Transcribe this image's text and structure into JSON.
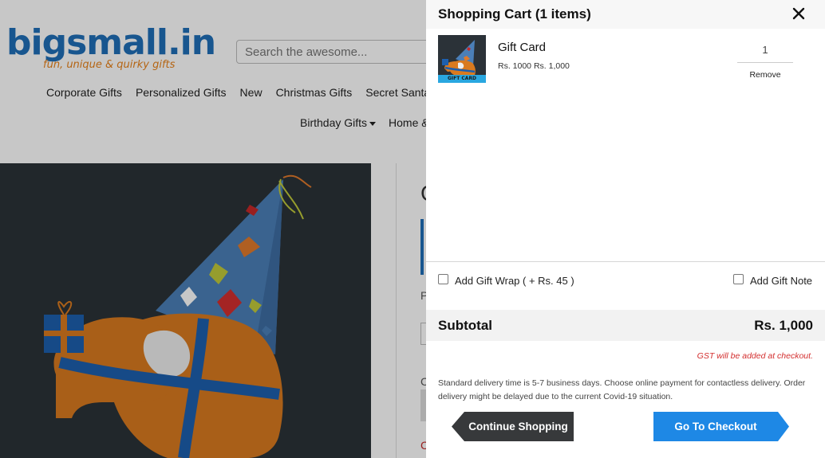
{
  "site": {
    "logo_text": "bigsmall.in",
    "logo_tagline": "fun, unique & quirky gifts",
    "search_placeholder": "Search the awesome...",
    "nav": [
      "Corporate Gifts",
      "Personalized Gifts",
      "New",
      "Christmas Gifts",
      "Secret Santa"
    ],
    "nav2": [
      "Birthday Gifts",
      "Home &"
    ],
    "product_title_fragment": "G",
    "product_p_fragment": "P",
    "product_c_fragment": "C",
    "product_red_fragment": "C"
  },
  "cart": {
    "title": "Shopping Cart (1 items)",
    "close_icon": "close-icon",
    "item": {
      "name": "Gift Card",
      "price": "Rs. 1000 Rs. 1,000",
      "qty": "1",
      "remove_label": "Remove",
      "thumb_label": "GIFT CARD"
    },
    "gift_wrap_label": "Add Gift Wrap ( + Rs. 45 )",
    "gift_note_label": "Add Gift Note",
    "subtotal_label": "Subtotal",
    "subtotal_value": "Rs. 1,000",
    "gst_note": "GST will be added at checkout.",
    "delivery_note": "Standard delivery time is 5-7 business days. Choose online payment for contactless delivery. Order delivery might be delayed due to the current Covid-19 situation.",
    "continue_label": "Continue Shopping",
    "checkout_label": "Go To Checkout"
  },
  "colors": {
    "brand_blue": "#1f6fb8",
    "brand_orange": "#e8821a",
    "checkout_blue": "#1e88e5",
    "continue_dark": "#37393b",
    "gst_red": "#d32f2f"
  }
}
